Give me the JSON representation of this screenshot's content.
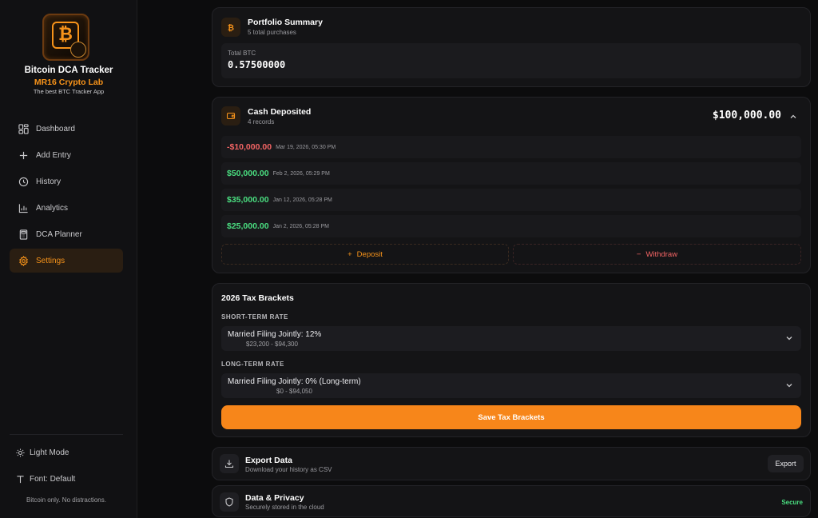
{
  "brand": {
    "title": "Bitcoin DCA Tracker",
    "subtitle": "MR16 Crypto Lab",
    "tagline": "The best BTC Tracker App"
  },
  "nav": [
    {
      "label": "Dashboard",
      "icon": "dashboard-icon"
    },
    {
      "label": "Add Entry",
      "icon": "plus-icon"
    },
    {
      "label": "History",
      "icon": "clock-icon"
    },
    {
      "label": "Analytics",
      "icon": "bar-chart-icon"
    },
    {
      "label": "DCA Planner",
      "icon": "calculator-icon"
    },
    {
      "label": "Settings",
      "icon": "gear-icon",
      "active": true
    }
  ],
  "sidebar_options": {
    "theme_toggle": "Light Mode",
    "font": "Font: Default",
    "footer": "Bitcoin only. No distractions."
  },
  "portfolio": {
    "title": "Portfolio Summary",
    "subtitle": "5 total purchases",
    "total_label": "Total BTC",
    "total_value": "0.57500000"
  },
  "cash": {
    "title": "Cash Deposited",
    "subtitle": "4 records",
    "total": "$100,000.00",
    "records": [
      {
        "amount": "-$10,000.00",
        "date": "Mar 19, 2026, 05:30 PM",
        "type": "neg"
      },
      {
        "amount": "$50,000.00",
        "date": "Feb 2, 2026, 05:29 PM",
        "type": "pos"
      },
      {
        "amount": "$35,000.00",
        "date": "Jan 12, 2026, 05:28 PM",
        "type": "pos"
      },
      {
        "amount": "$25,000.00",
        "date": "Jan 2, 2026, 05:28 PM",
        "type": "pos"
      }
    ],
    "deposit_label": "Deposit",
    "withdraw_label": "Withdraw"
  },
  "tax": {
    "title": "2026 Tax Brackets",
    "short_label": "SHORT-TERM RATE",
    "short_value": "Married Filing Jointly: 12%",
    "short_range": "$23,200 - $94,300",
    "long_label": "LONG-TERM RATE",
    "long_value": "Married Filing Jointly: 0% (Long-term)",
    "long_range": "$0 - $94,050",
    "save_label": "Save Tax Brackets"
  },
  "export": {
    "title": "Export Data",
    "subtitle": "Download your history as CSV",
    "button": "Export"
  },
  "privacy": {
    "title": "Data & Privacy",
    "subtitle": "Securely stored in the cloud",
    "status": "Secure"
  },
  "colors": {
    "accent": "#f7931a",
    "positive": "#4ade80",
    "negative": "#f26464",
    "background": "#0c0c0d"
  }
}
